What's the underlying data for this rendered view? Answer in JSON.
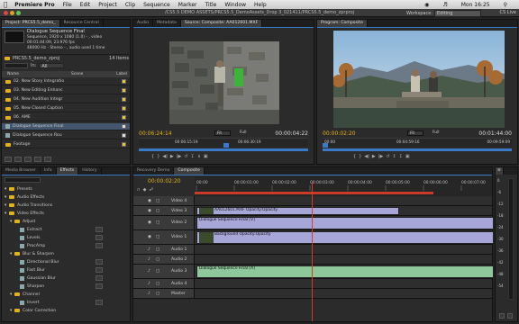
{
  "menubar": {
    "app": "Premiere Pro",
    "items": [
      "File",
      "Edit",
      "Project",
      "Clip",
      "Sequence",
      "Marker",
      "Title",
      "Window",
      "Help"
    ],
    "clock": "Mon 16:25"
  },
  "titlebar": {
    "path": "/CS5.5 DEMO ASSETS/PRCS5.5_DemoAssets_Drop 3_021411/PRCS5.5_demo_zprproj",
    "workspace_label": "Workspace:",
    "workspace_value": "Editing",
    "cslive": "CS Live"
  },
  "project": {
    "tabs": [
      "Project: PRCS5.5_demo_",
      "Resource Central"
    ],
    "clip_name": "Dialogue Sequence Final",
    "info1": "Sequence, 1920 x 1080 (1.0) - , video",
    "info2": "00:01:44:09, 23.976 fps",
    "info3": "48000 Hz - Stereo - , audio used 1 time",
    "bin": "PRCS5.5_demo_zproj",
    "items_count": "14 Items",
    "in_label": "In:",
    "in_value": "All",
    "col_name": "Name",
    "col_scene": "Scene",
    "col_label": "Label",
    "rows": [
      "02. New Story Integratio",
      "03. New Editing Enhanc",
      "04. New Audition Integr",
      "05. New Closed Caption",
      "06. AME",
      "Dialogue Sequence Final",
      "Dialogue Sequence Rou",
      "Footage"
    ]
  },
  "source": {
    "tabs": [
      "Audio",
      "Metadata",
      "Source: Composite: AA012601.MXF",
      "00:00:04:22"
    ],
    "timecode_left": "00:06:24:14",
    "timecode_right": "00:00:04:22",
    "fit": "Fit",
    "full": "Full",
    "ruler_left": "00:06:15:19",
    "ruler_right": "00:06:30:19"
  },
  "program": {
    "tabs": [
      "Program: Composite"
    ],
    "timecode_left": "00:00:02:20",
    "timecode_right": "00:01:44:00",
    "fit": "Fit",
    "full": "Full",
    "ruler_left": "00:00",
    "ruler_mid": "00:04:59:16",
    "ruler_right": "00:09:59:09"
  },
  "effects": {
    "tabs": [
      "Media Browser",
      "Info",
      "Effects",
      "History"
    ],
    "items": [
      {
        "label": "Presets",
        "level": 0
      },
      {
        "label": "Audio Effects",
        "level": 0
      },
      {
        "label": "Audio Transitions",
        "level": 0
      },
      {
        "label": "Video Effects",
        "level": 0
      },
      {
        "label": "Adjust",
        "level": 1
      },
      {
        "label": "Extract",
        "level": 2
      },
      {
        "label": "Levels",
        "level": 2
      },
      {
        "label": "ProcAmp",
        "level": 2
      },
      {
        "label": "Blur & Sharpen",
        "level": 1
      },
      {
        "label": "Directional Blur",
        "level": 2
      },
      {
        "label": "Fast Blur",
        "level": 2
      },
      {
        "label": "Gaussian Blur",
        "level": 2
      },
      {
        "label": "Sharpen",
        "level": 2
      },
      {
        "label": "Channel",
        "level": 1
      },
      {
        "label": "Invert",
        "level": 2
      },
      {
        "label": "Color Correction",
        "level": 1
      }
    ]
  },
  "timeline": {
    "tabs": [
      "Recovery Demo",
      "Composite"
    ],
    "timecode": "00:00:02:20",
    "ruler": [
      "00:00",
      "00:00:01:00",
      "00:00:02:00",
      "00:00:03:00",
      "00:00:04:00",
      "00:00:05:00",
      "00:00:06:00",
      "00:00:07:00"
    ],
    "tracks": [
      "Video 4",
      "Video 3",
      "Video 2",
      "Video 1",
      "Audio 1",
      "Audio 2",
      "Audio 3",
      "Audio 4",
      "Master"
    ],
    "clips": {
      "v3": "AA012601.MXF  Opacity:Opacity",
      "v2": "Dialogue Sequence Final [V]",
      "v1": "Background  Opacity:Opacity",
      "a3": "Dialogue Sequence Final [A]"
    }
  },
  "meter": {
    "labels": [
      "0",
      "-6",
      "-12",
      "-18",
      "-24",
      "-30",
      "-36",
      "-42",
      "-48",
      "-54"
    ]
  },
  "colors": {
    "accent_blue": "#3a78c8",
    "timecode_yellow": "#e3b11a",
    "playhead": "#d04020",
    "video_clip": "#a6a6d8",
    "audio_clip": "#8ec79a"
  }
}
